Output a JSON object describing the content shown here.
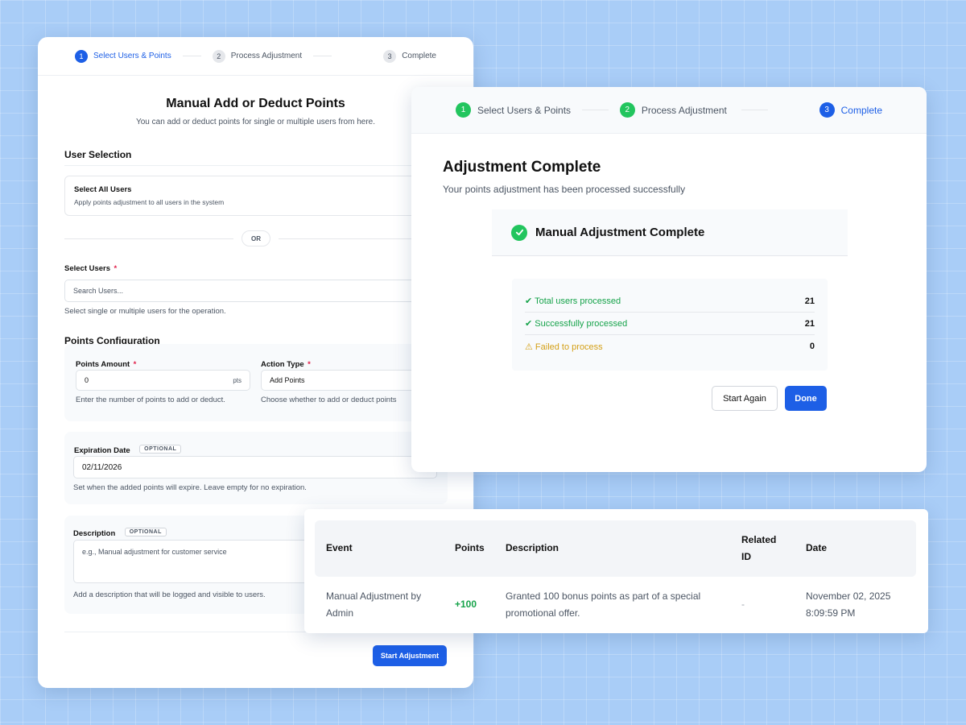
{
  "form": {
    "steps": [
      {
        "num": "1",
        "label": "Select Users & Points"
      },
      {
        "num": "2",
        "label": "Process Adjustment"
      },
      {
        "num": "3",
        "label": "Complete"
      }
    ],
    "title": "Manual Add or Deduct Points",
    "subtitle": "You can add or deduct points for single or multiple users from here.",
    "user_selection": {
      "heading": "User Selection",
      "select_all_title": "Select All Users",
      "select_all_desc": "Apply points adjustment to all users in the system",
      "or_label": "OR",
      "select_users_label": "Select Users",
      "required_mark": "*",
      "search_placeholder": "Search Users...",
      "help": "Select single or multiple users for the operation."
    },
    "points_config": {
      "heading": "Points Configuration",
      "amount_label": "Points Amount",
      "amount_value": "0",
      "amount_suffix": "pts",
      "amount_help": "Enter the number of points to add or deduct.",
      "action_label": "Action Type",
      "action_value": "Add Points",
      "action_help": "Choose whether to add or deduct points"
    },
    "expiration": {
      "label": "Expiration Date",
      "optional": "OPTIONAL",
      "value": "02/11/2026",
      "help": "Set when the added points will expire. Leave empty for no expiration."
    },
    "description": {
      "label": "Description",
      "optional": "OPTIONAL",
      "placeholder": "e.g., Manual adjustment for customer service",
      "help": "Add a description that will be logged and visible to users."
    },
    "submit_label": "Start Adjustment"
  },
  "complete": {
    "steps": [
      {
        "num": "1",
        "label": "Select Users & Points"
      },
      {
        "num": "2",
        "label": "Process Adjustment"
      },
      {
        "num": "3",
        "label": "Complete"
      }
    ],
    "title": "Adjustment Complete",
    "subtitle": "Your points adjustment has been processed successfully",
    "banner": "Manual Adjustment Complete",
    "stats": [
      {
        "label": "✔ Total users processed",
        "value": "21"
      },
      {
        "label": "✔ Successfully processed",
        "value": "21"
      },
      {
        "label": "⚠ Failed to process",
        "value": "0"
      }
    ],
    "start_again_label": "Start Again",
    "done_label": "Done"
  },
  "history": {
    "headers": {
      "event": "Event",
      "points": "Points",
      "description": "Description",
      "related_line1": "Related",
      "related_line2": "ID",
      "date": "Date"
    },
    "row": {
      "event_line1": "Manual Adjustment by",
      "event_line2": "Admin",
      "points": "+100",
      "desc_line1": "Granted 100 bonus points as part of a special",
      "desc_line2": "promotional offer.",
      "related_id": "-",
      "date_line1": "November 02, 2025",
      "date_line2": "8:09:59 PM"
    }
  },
  "colors": {
    "primary": "#1d5fe6",
    "success": "#22c55e",
    "warning": "#d4a017",
    "points_positive": "#16a34a"
  }
}
